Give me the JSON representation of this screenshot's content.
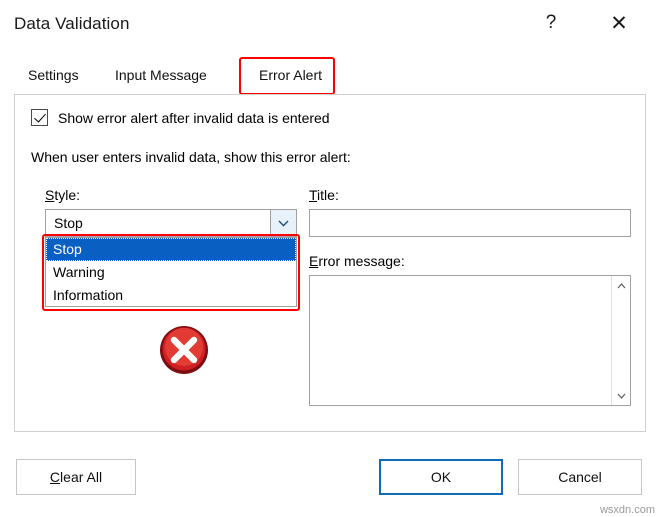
{
  "window": {
    "title": "Data Validation",
    "help_icon": "?",
    "close_icon": "✕"
  },
  "tabs": [
    {
      "label": "Settings",
      "active": false
    },
    {
      "label": "Input Message",
      "active": false
    },
    {
      "label": "Error Alert",
      "active": true
    }
  ],
  "panel": {
    "checkbox_label": "Show error alert after invalid data is entered",
    "checkbox_checked": true,
    "prompt": "When user enters invalid data, show this error alert:",
    "style_label": "Style:",
    "style_value": "Stop",
    "style_options": [
      "Stop",
      "Warning",
      "Information"
    ],
    "style_selected": "Stop",
    "title_label": "Title:",
    "title_value": "",
    "error_message_label": "Error message:",
    "error_message_value": "",
    "icon_name": "stop-error-icon"
  },
  "footer": {
    "clear_all": "Clear All",
    "ok": "OK",
    "cancel": "Cancel"
  },
  "annotations": {
    "tab_highlight_color": "#ff0000",
    "dropdown_highlight_color": "#ff0000",
    "selection_color": "#0a5fc2"
  },
  "watermark": "wsxdn.com"
}
